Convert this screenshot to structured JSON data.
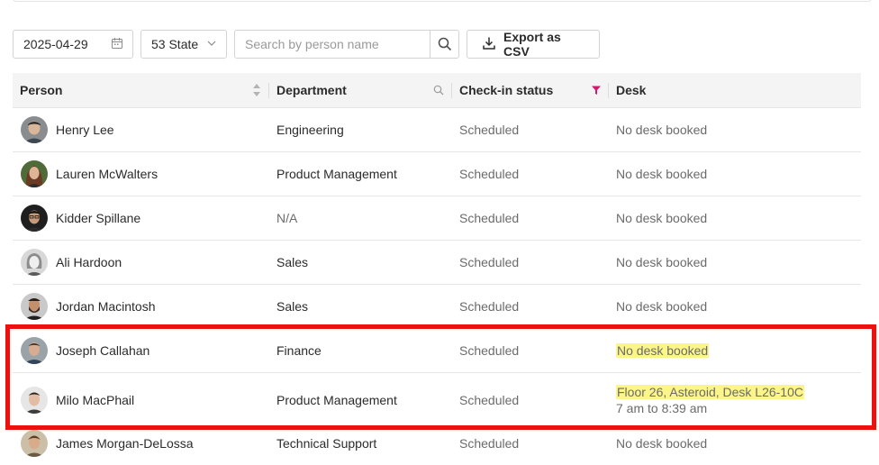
{
  "toolbar": {
    "date_value": "2025-04-29",
    "building_value": "53 State",
    "search_placeholder": "Search by person name",
    "export_label": "Export as CSV"
  },
  "columns": {
    "person": "Person",
    "department": "Department",
    "checkin": "Check-in status",
    "desk": "Desk"
  },
  "colors": {
    "highlight": "#fcf58a",
    "filter_active": "#d4186c",
    "annotation_box": "#ee0f0f"
  },
  "rows": [
    {
      "name": "Henry Lee",
      "department": "Engineering",
      "status": "Scheduled",
      "desk": "No desk booked"
    },
    {
      "name": "Lauren McWalters",
      "department": "Product Management",
      "status": "Scheduled",
      "desk": "No desk booked"
    },
    {
      "name": "Kidder Spillane",
      "department": "N/A",
      "status": "Scheduled",
      "desk": "No desk booked"
    },
    {
      "name": "Ali Hardoon",
      "department": "Sales",
      "status": "Scheduled",
      "desk": "No desk booked"
    },
    {
      "name": "Jordan Macintosh",
      "department": "Sales",
      "status": "Scheduled",
      "desk": "No desk booked"
    },
    {
      "name": "Joseph Callahan",
      "department": "Finance",
      "status": "Scheduled",
      "desk": "No desk booked"
    },
    {
      "name": "Milo MacPhail",
      "department": "Product Management",
      "status": "Scheduled",
      "desk": "Floor 26, Asteroid, Desk L26-10C",
      "desk_time": "7 am to 8:39 am"
    },
    {
      "name": "James Morgan-DeLossa",
      "department": "Technical Support",
      "status": "Scheduled",
      "desk": "No desk booked"
    }
  ]
}
